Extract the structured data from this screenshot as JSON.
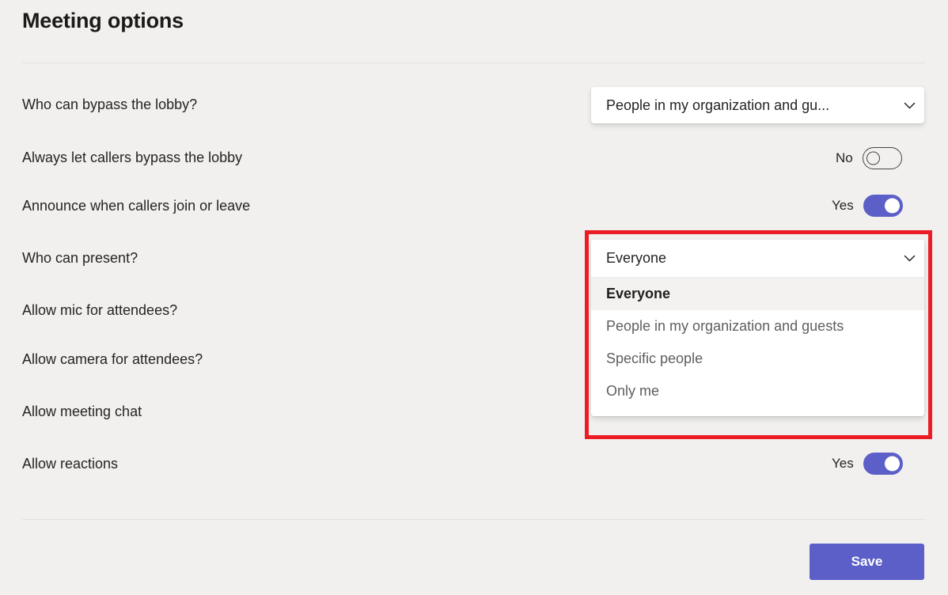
{
  "page": {
    "title": "Meeting options",
    "background_color": "#f1f0ef"
  },
  "colors": {
    "accent": "#5b5fc7",
    "highlight_annotation": "#ec1c24",
    "text_primary": "#252423",
    "option_text": "#605e5c",
    "selected_option_bg": "#f3f2f1"
  },
  "rows": {
    "bypass_lobby": {
      "label": "Who can bypass the lobby?",
      "control": "dropdown",
      "value": "People in my organization and gu..."
    },
    "callers_bypass": {
      "label": "Always let callers bypass the lobby",
      "control": "toggle",
      "state_label": "No",
      "on": false
    },
    "announce_callers": {
      "label": "Announce when callers join or leave",
      "control": "toggle",
      "state_label": "Yes",
      "on": true
    },
    "who_can_present": {
      "label": "Who can present?",
      "control": "combobox-open",
      "value": "Everyone",
      "options": [
        "Everyone",
        "People in my organization and guests",
        "Specific people",
        "Only me"
      ],
      "selected_index": 0
    },
    "allow_mic": {
      "label": "Allow mic for attendees?"
    },
    "allow_camera": {
      "label": "Allow camera for attendees?"
    },
    "allow_chat": {
      "label": "Allow meeting chat"
    },
    "allow_reactions": {
      "label": "Allow reactions",
      "control": "toggle",
      "state_label": "Yes",
      "on": true
    }
  },
  "footer": {
    "save_label": "Save"
  },
  "icons": {
    "chevron_down": "chevron-down-icon"
  }
}
